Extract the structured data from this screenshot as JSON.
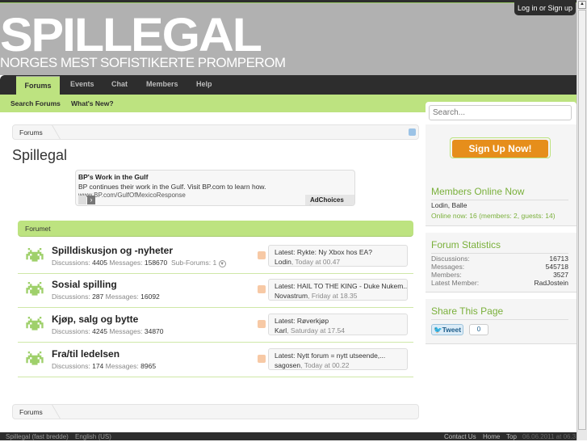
{
  "header": {
    "logo": "SPILLEGAL",
    "tagline": "NORGES MEST SOFISTIKERTE PROMPEROM",
    "login": "Log in or Sign up"
  },
  "nav": {
    "tabs": [
      "Forums",
      "Events",
      "Chat",
      "Members",
      "Help"
    ],
    "sub": [
      "Search Forums",
      "What's New?"
    ]
  },
  "breadcrumb": "Forums",
  "page_title": "Spillegal",
  "ad": {
    "title": "BP's Work in the Gulf",
    "text": "BP continues their work in the Gulf. Visit BP.com to learn how.",
    "url": "www.BP.com/GulfOfMexicoResponse",
    "choices": "AdChoices"
  },
  "category": "Forumet",
  "forums": [
    {
      "name": "Spilldiskusjon og -nyheter",
      "disc_label": "Discussions:",
      "disc": "4405",
      "msg_label": "Messages:",
      "msg": "158670",
      "sub": "Sub-Forums: 1",
      "latest": "Latest: Rykte: Ny Xbox hos EA?",
      "user": "Lodin",
      "time": ", Today at 00.47"
    },
    {
      "name": "Sosial spilling",
      "disc_label": "Discussions:",
      "disc": "287",
      "msg_label": "Messages:",
      "msg": "16092",
      "latest": "Latest: HAIL TO THE KING - Duke Nukem...",
      "user": "Novastrum",
      "time": ", Friday at 18.35"
    },
    {
      "name": "Kjøp, salg og bytte",
      "disc_label": "Discussions:",
      "disc": "4245",
      "msg_label": "Messages:",
      "msg": "34870",
      "latest": "Latest: Røverkjøp",
      "user": "Karl",
      "time": ", Saturday at 17.54"
    },
    {
      "name": "Fra/til ledelsen",
      "disc_label": "Discussions:",
      "disc": "174",
      "msg_label": "Messages:",
      "msg": "8965",
      "latest": "Latest: Nytt forum = nytt utseende,...",
      "user": "sagosen",
      "time": ", Today at 00.22"
    }
  ],
  "sidebar": {
    "search_placeholder": "Search...",
    "signup": "Sign Up Now!",
    "online": {
      "title": "Members Online Now",
      "members": "Lodin, Balle",
      "summary": "Online now: 16 (members: 2, guests: 14)"
    },
    "stats": {
      "title": "Forum Statistics",
      "rows": [
        [
          "Discussions:",
          "16713"
        ],
        [
          "Messages:",
          "545718"
        ],
        [
          "Members:",
          "3527"
        ],
        [
          "Latest Member:",
          "RadJostein"
        ]
      ]
    },
    "share": {
      "title": "Share This Page",
      "tweet": "Tweet",
      "count": "0"
    }
  },
  "footer": {
    "left": [
      "Spillegal (fast bredde)",
      "English (US)"
    ],
    "right": [
      "Contact Us",
      "Home",
      "Top"
    ],
    "date": "06.06.2011 at 06.3"
  }
}
